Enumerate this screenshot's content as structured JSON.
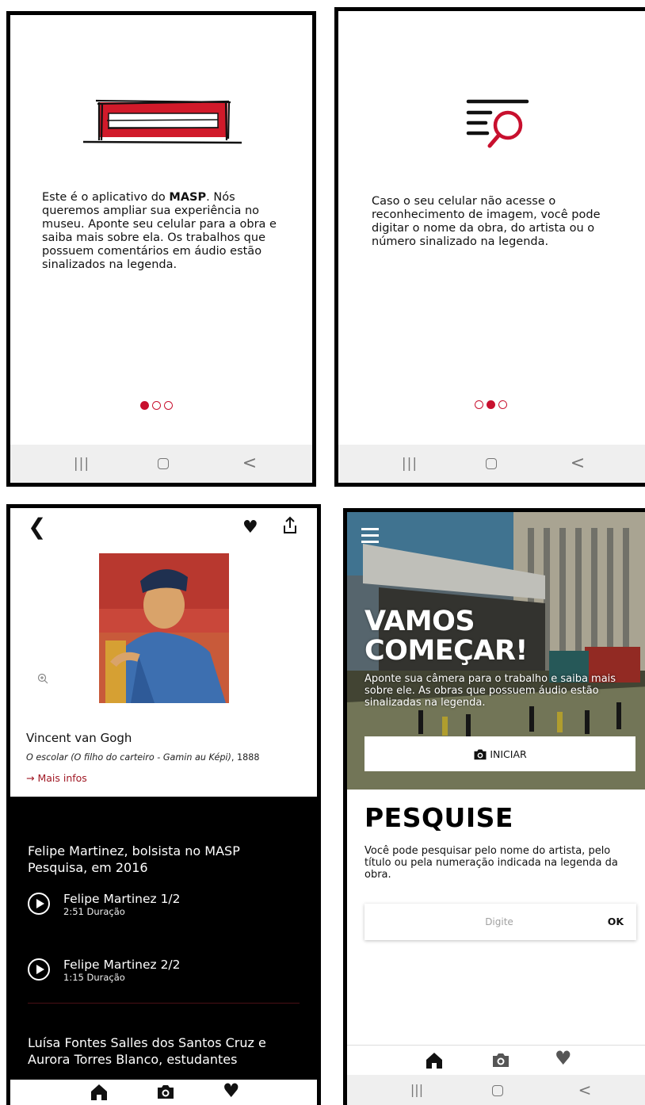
{
  "onboarding_1": {
    "text_before": "Este é o aplicativo do ",
    "text_bold": "MASP",
    "text_after": ". Nós queremos ampliar sua experiência no museu. Aponte seu celular para a obra e saiba mais sobre ela. Os trabalhos que possuem comentários em áudio estão sinalizados na legenda.",
    "page_index": 1,
    "page_count": 3
  },
  "onboarding_2": {
    "text": "Caso o seu celular não acesse o reconhecimento de imagem, você pode digitar o nome da obra, do artista ou o número sinalizado na legenda.",
    "page_index": 2,
    "page_count": 3
  },
  "system_nav": {
    "recents_glyph": "|||",
    "back_glyph": "<"
  },
  "detail": {
    "artist": "Vincent van Gogh",
    "artwork_title": "O escolar (O filho do carteiro - Gamin au Képi)",
    "artwork_year": ", 1888",
    "more_info": "→ Mais infos",
    "audio_group_1": "Felipe Martinez, bolsista no MASP Pesquisa, em 2016",
    "tracks": [
      {
        "title": "Felipe Martinez 1/2",
        "duration": "2:51 Duração"
      },
      {
        "title": "Felipe Martinez 2/2",
        "duration": "1:15 Duração"
      }
    ],
    "audio_group_2": "Luísa Fontes Salles dos Santos Cruz e Aurora Torres Blanco, estudantes"
  },
  "home": {
    "hero_title_1": "VAMOS",
    "hero_title_2": "COMEÇAR!",
    "hero_text": "Aponte sua câmera para o trabalho e saiba mais sobre ele. As obras que possuem áudio estão sinalizadas na legenda.",
    "start_button": "INICIAR",
    "search_title": "PESQUISE",
    "search_text": "Você pode pesquisar pelo nome do artista, pelo título ou pela numeração indicada na legenda da obra.",
    "search_placeholder": "Digite",
    "search_ok": "OK"
  },
  "colors": {
    "accent_red": "#c8102e",
    "dark_panel": "#000000",
    "nav_bar_gray": "#efefef"
  },
  "icons": [
    "masp-building-icon",
    "search-list-icon",
    "back-chevron-icon",
    "heart-icon",
    "share-icon",
    "zoom-in-icon",
    "play-icon",
    "home-icon",
    "camera-icon",
    "menu-icon"
  ]
}
